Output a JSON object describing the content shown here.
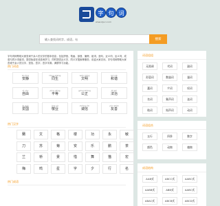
{
  "header": {
    "logo_chars": [
      "字",
      "句",
      "词"
    ],
    "logo_subtitle": "www.zijuci.com",
    "search_placeholder": "输入查找词的字，成语，句",
    "search_button": "搜索"
  },
  "intro": "字句词网帮助大家查询千余人的汉字的基本信息，包括拼音、笔画、部首、偏旁、组词、造句、近义词、反义词、成语与同义词组词，提供免费在线查询学习，同时提供近义字、同义字搜索等服务，欢迎大家访问。字句词网帮助大家查询千余人的汉字，查找，查字，查字字典，满屏学习功能。",
  "popular_words": {
    "title": "热门词语",
    "items": [
      {
        "py": "ān jìng",
        "hz": "安静"
      },
      {
        "py": "tóng shēng",
        "hz": "同生"
      },
      {
        "py": "wén míng",
        "hz": "文明"
      },
      {
        "py": "hé xié",
        "hz": "和谐"
      },
      {
        "py": "zì yóu",
        "hz": "自由"
      },
      {
        "py": "píng děng",
        "hz": "平等"
      },
      {
        "py": "gōng zhèng",
        "hz": "公正"
      },
      {
        "py": "fǎ zhì",
        "hz": "法治"
      },
      {
        "py": "ài guó",
        "hz": "爱国"
      },
      {
        "py": "jìng yè",
        "hz": "敬业"
      },
      {
        "py": "chéng xìn",
        "hz": "诚信"
      },
      {
        "py": "yǒu shàn",
        "hz": "友善"
      }
    ]
  },
  "popular_chars": {
    "title": "热门汉字",
    "items": [
      "蘭",
      "文",
      "格",
      "楼",
      "功",
      "永",
      "敏",
      "刀",
      "苏",
      "菊",
      "安",
      "乐",
      "鹏",
      "茶",
      "兰",
      "桥",
      "景",
      "惜",
      "舞",
      "猫",
      "宏",
      "梅",
      "鸣",
      "星",
      "字",
      "夕",
      "行",
      "名",
      "虎",
      "野",
      "莲",
      "浩",
      "甄",
      "悠",
      "坎",
      "翼",
      "明",
      "德",
      "嗳",
      "旺",
      "荣",
      "诗",
      "鸢",
      "福",
      "成",
      "佳",
      "昆",
      "欣",
      "语",
      "飞",
      "炬",
      "城"
    ]
  },
  "popular_idioms": {
    "title": "热门成语"
  },
  "side_word_groups": {
    "title": "词语组组",
    "items": [
      "无限调",
      "代词",
      "副词",
      "形容词",
      "数量词",
      "量词",
      "嘉词",
      "介词",
      "叹词",
      "名词",
      "象声词",
      "连词",
      "助词",
      "拟声词",
      "动词",
      "嘴叫词语"
    ]
  },
  "side_idiom_groups": {
    "title": "词语组合",
    "items": [
      "五行",
      "四季",
      "数字",
      "颜色",
      "动物",
      "植物",
      "方位",
      "名称",
      "自然"
    ]
  },
  "side_patterns": {
    "title": "成语结构",
    "items": [
      "AAB式",
      "ABCC式",
      "AABC式",
      "AABB式",
      "ABB式",
      "AABC式",
      "ABAC式",
      "ABCB式",
      "ABCD式",
      "ABBC式",
      "AABB式",
      "ABBA式"
    ]
  }
}
